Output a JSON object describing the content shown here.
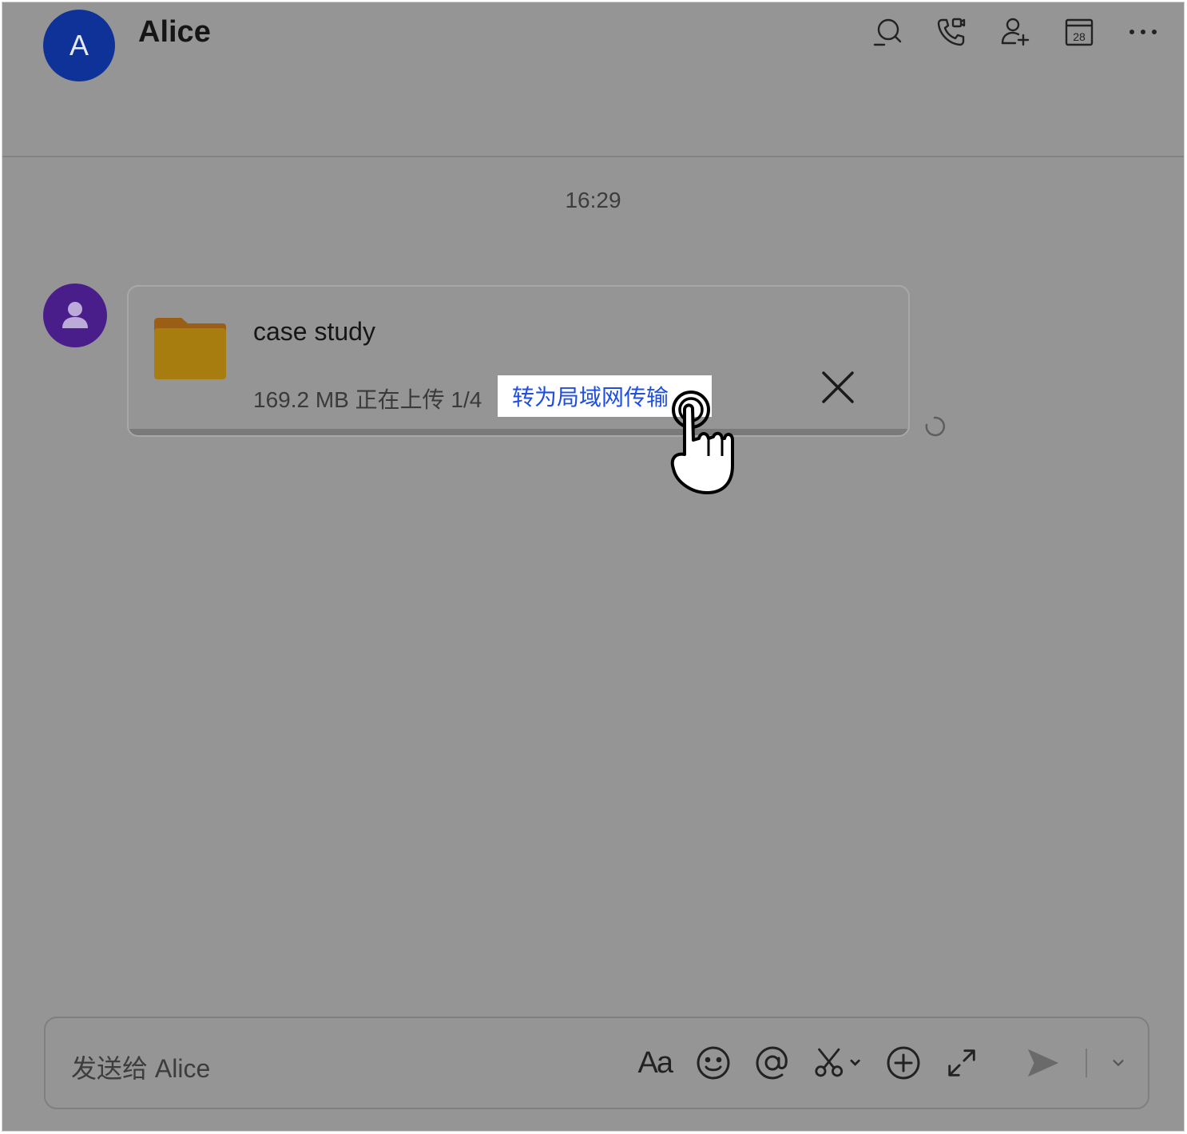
{
  "header": {
    "avatar_letter": "A",
    "contact_name": "Alice",
    "icons": [
      "search-icon",
      "phone-video-icon",
      "add-user-icon",
      "calendar-icon",
      "more-icon"
    ],
    "calendar_day": "28"
  },
  "chat": {
    "timestamp": "16:29",
    "file": {
      "name": "case study",
      "meta": "169.2 MB 正在上传 1/4",
      "lan_transfer_label": "转为局域网传输"
    }
  },
  "composer": {
    "placeholder": "发送给 Alice",
    "format_label": "Aa"
  },
  "colors": {
    "avatar_a": "#0f3299",
    "avatar_user": "#4a1e8a",
    "folder": "#a77d10",
    "link": "#1f4ee0"
  }
}
